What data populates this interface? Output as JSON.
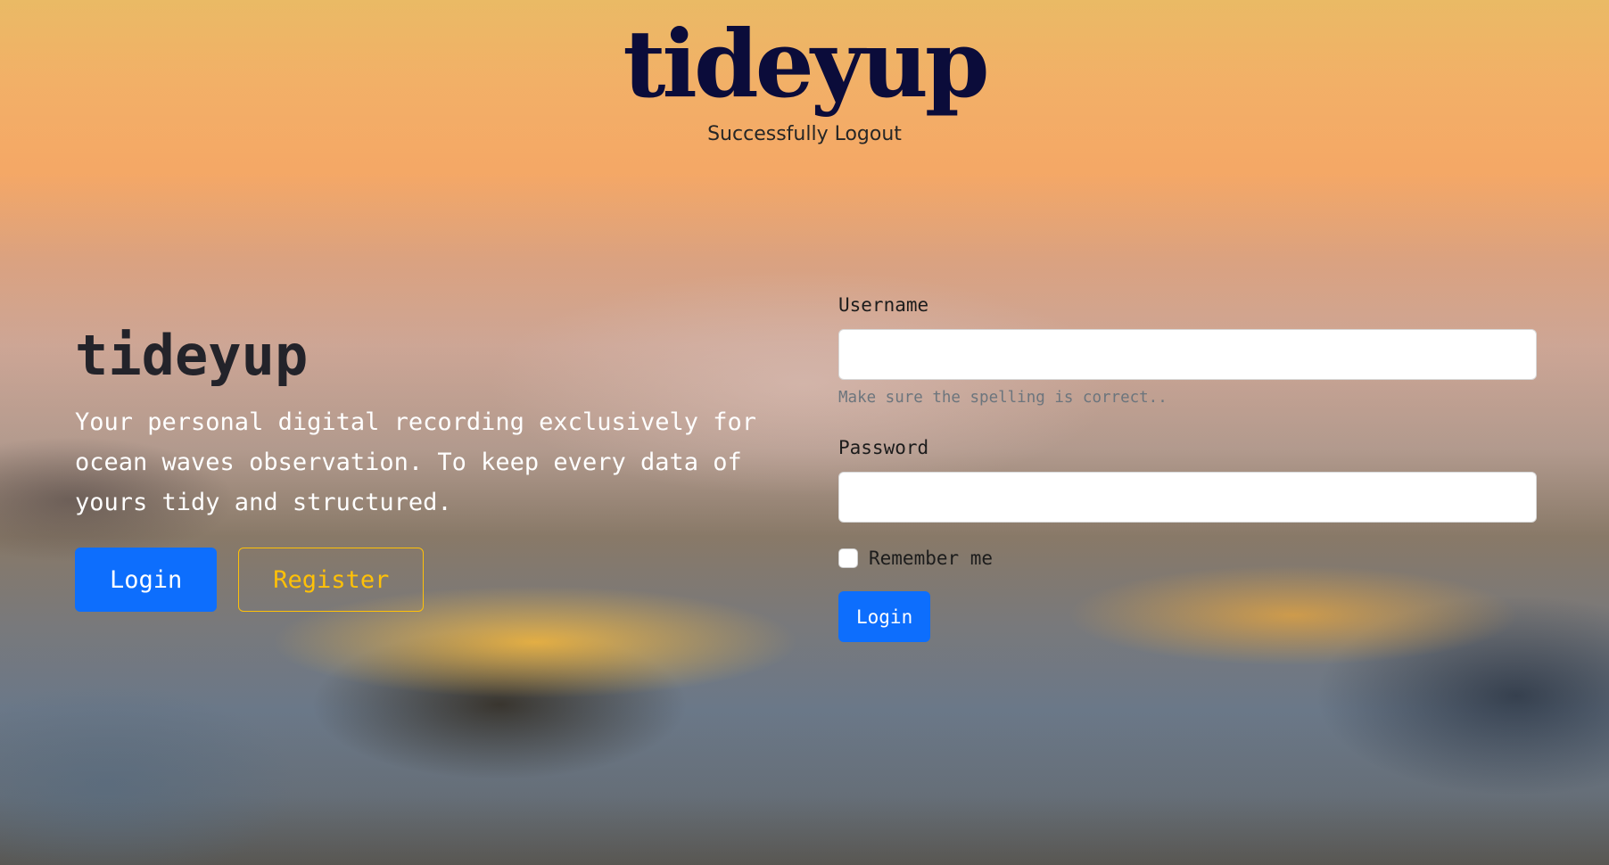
{
  "header": {
    "logo_text": "tideyup",
    "flash_message": "Successfully Logout"
  },
  "hero": {
    "title": "tideyup",
    "lead": "Your personal digital recording exclusively for ocean waves observation. To keep every data of yours tidy and structured.",
    "login_label": "Login",
    "register_label": "Register"
  },
  "form": {
    "username_label": "Username",
    "username_value": "",
    "username_help": "Make sure the spelling is correct..",
    "password_label": "Password",
    "password_value": "",
    "remember_label": "Remember me",
    "remember_checked": false,
    "submit_label": "Login"
  },
  "colors": {
    "primary": "#0d6efd",
    "warning": "#ffc107",
    "logo": "#0b0c3a"
  }
}
